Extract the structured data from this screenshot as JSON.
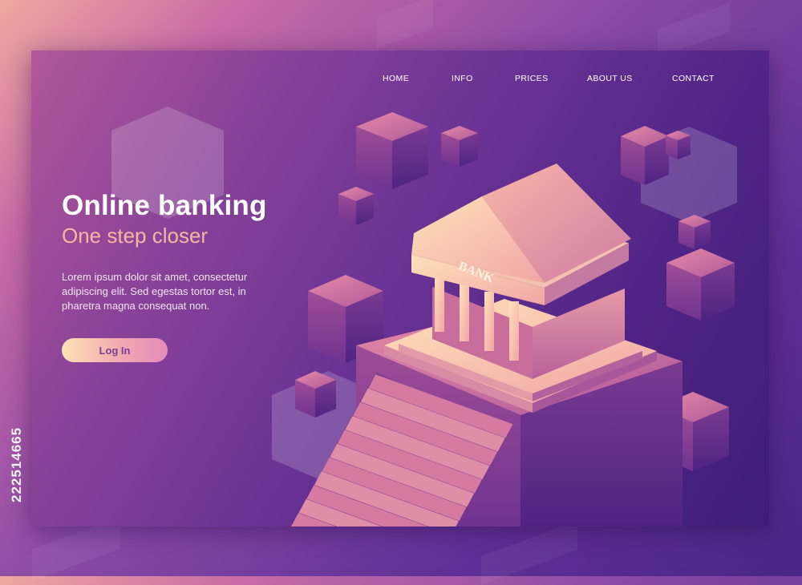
{
  "stock_id": "222514665",
  "nav": {
    "items": [
      {
        "label": "HOME"
      },
      {
        "label": "INFO"
      },
      {
        "label": "PRICES"
      },
      {
        "label": "ABOUT US"
      },
      {
        "label": "CONTACT"
      }
    ]
  },
  "hero": {
    "title": "Online banking",
    "subtitle": "One step closer",
    "body": "Lorem ipsum dolor sit amet, consectetur adipiscing elit. Sed egestas tortor est, in pharetra magna consequat non.",
    "cta_label": "Log In"
  },
  "illustration": {
    "bank_sign": "BANK"
  },
  "colors": {
    "accent": "#f4b7a3",
    "button_gradient_start": "#fde1b4",
    "button_gradient_end": "#e58ab8",
    "card_dark": "#3f1d78"
  }
}
